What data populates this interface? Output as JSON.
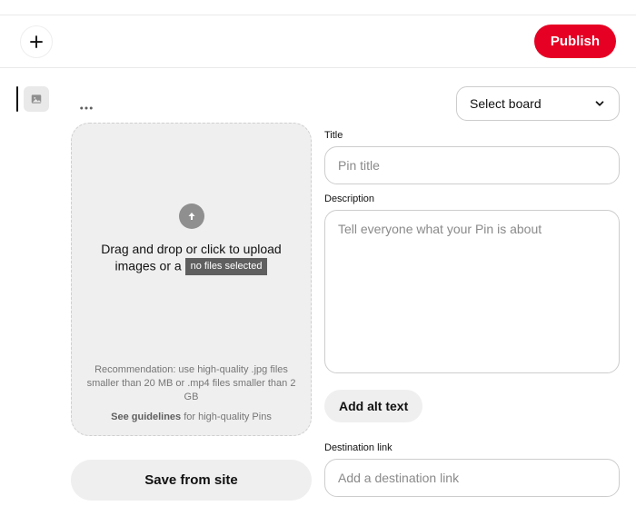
{
  "header": {
    "publish_label": "Publish"
  },
  "board_select": {
    "placeholder": "Select board"
  },
  "upload": {
    "drop_text": "Drag and drop or click to upload images or a",
    "file_chip": "no files selected",
    "recommendation": "Recommendation: use high-quality .jpg files smaller than 20 MB or .mp4 files smaller than 2 GB",
    "guidelines_bold": "See guidelines",
    "guidelines_rest": " for high-quality Pins",
    "save_from_site_label": "Save from site"
  },
  "form": {
    "title_label": "Title",
    "title_placeholder": "Pin title",
    "description_label": "Description",
    "description_placeholder": "Tell everyone what your Pin is about",
    "alt_text_label": "Add alt text",
    "destination_label": "Destination link",
    "destination_placeholder": "Add a destination link"
  }
}
